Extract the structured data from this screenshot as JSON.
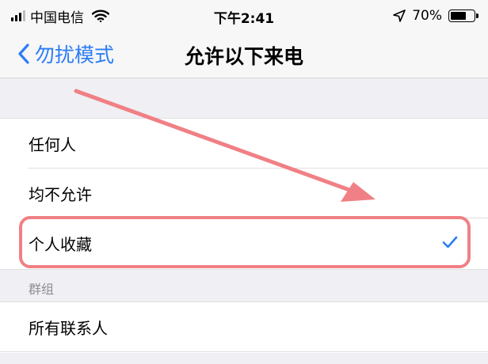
{
  "status_bar": {
    "carrier": "中国电信",
    "time": "下午2:41",
    "battery_percent": "70%",
    "battery_level": 0.7
  },
  "nav": {
    "back_label": "勿扰模式",
    "title": "允许以下来电"
  },
  "options": [
    {
      "label": "任何人",
      "selected": false
    },
    {
      "label": "均不允许",
      "selected": false
    },
    {
      "label": "个人收藏",
      "selected": true
    }
  ],
  "group": {
    "header": "群组",
    "items": [
      {
        "label": "所有联系人"
      }
    ]
  },
  "colors": {
    "accent": "#2b7cf6",
    "annotation": "#f08085",
    "group_header_text": "#8e8e93",
    "background_gray": "#efeff4"
  },
  "icons": {
    "back": "chevron-left-icon",
    "check": "checkmark-icon",
    "wifi": "wifi-icon",
    "location": "location-arrow-icon",
    "signal": "signal-icon",
    "battery": "battery-icon"
  }
}
